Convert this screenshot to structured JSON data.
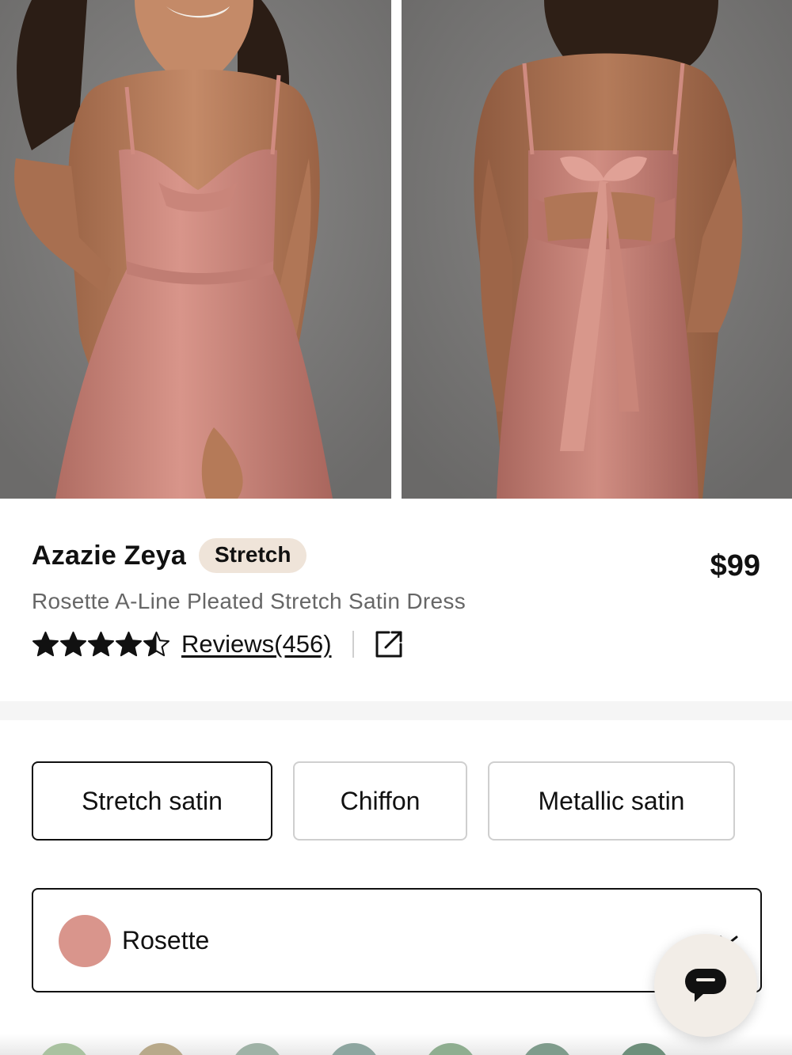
{
  "gallery": {
    "images": [
      {
        "alt": "front-view",
        "icon": "model-front-photo"
      },
      {
        "alt": "back-view",
        "icon": "model-back-photo"
      }
    ]
  },
  "product": {
    "brand": "Azazie Zeya",
    "badge": "Stretch",
    "price": "$99",
    "subtitle": "Rosette A-Line Pleated Stretch Satin Dress",
    "rating": 4.5,
    "reviews_label": "Reviews(456)"
  },
  "fabrics": {
    "selected": "Stretch satin",
    "options": [
      "Stretch satin",
      "Chiffon",
      "Metallic satin"
    ]
  },
  "color": {
    "selected_name": "Rosette",
    "selected_hex": "#d9958c",
    "swatches": [
      "#a9c2a0",
      "#b8a98a",
      "#9fb2a6",
      "#8ea6a0",
      "#8fae90",
      "#7f9c8c",
      "#6e8f7b"
    ]
  },
  "colors": {
    "text": "#111111",
    "muted": "#666666",
    "badge_bg": "#efe4d9",
    "chat_bg": "#f2ede7"
  },
  "icons": {
    "share": "external-link-icon",
    "chat": "chat-bubble-icon",
    "chevron": "chevron-icon"
  }
}
